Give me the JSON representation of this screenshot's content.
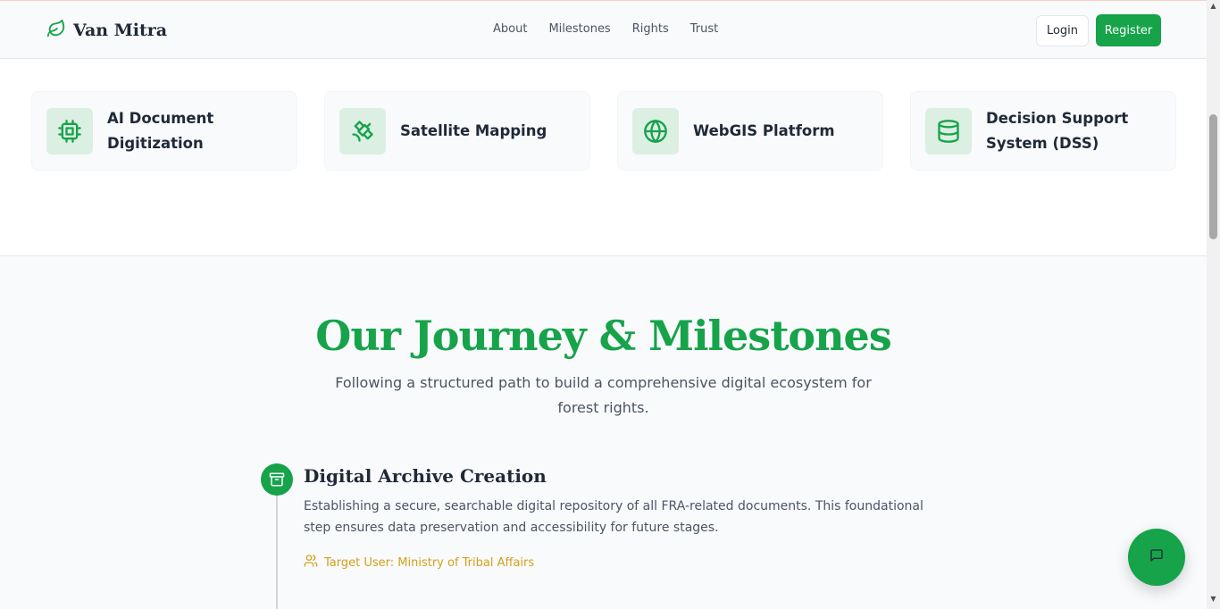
{
  "header": {
    "brand": "Van Mitra",
    "nav": [
      "About",
      "Milestones",
      "Rights",
      "Trust"
    ],
    "login_label": "Login",
    "register_label": "Register"
  },
  "features": [
    {
      "label": "AI Document Digitization",
      "icon": "cpu-chip-icon"
    },
    {
      "label": "Satellite Mapping",
      "icon": "satellite-icon"
    },
    {
      "label": "WebGIS Platform",
      "icon": "globe-icon"
    },
    {
      "label": "Decision Support System (DSS)",
      "icon": "database-icon"
    }
  ],
  "journey": {
    "title": "Our Journey & Milestones",
    "subtitle": "Following a structured path to build a comprehensive digital ecosystem for forest rights.",
    "milestones": [
      {
        "title": "Digital Archive Creation",
        "description": "Establishing a secure, searchable digital repository of all FRA-related documents. This foundational step ensures data preservation and accessibility for future stages.",
        "target": "Target User: Ministry of Tribal Affairs",
        "icon": "archive-box-icon"
      }
    ]
  },
  "chat_button": {
    "icon": "chat-bubble-icon"
  },
  "colors": {
    "accent": "#16a34a",
    "target": "#d4a017",
    "icon_bg": "#dcefe3"
  }
}
